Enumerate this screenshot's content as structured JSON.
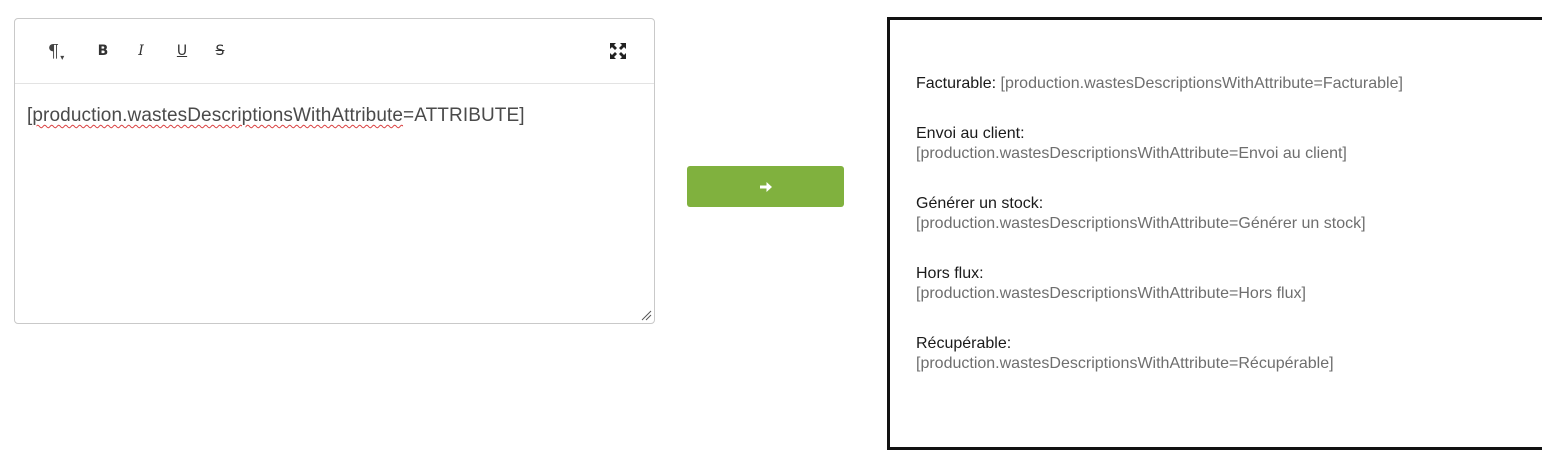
{
  "editor": {
    "toolbar": {
      "paragraph_icon": "paragraph-icon",
      "bold_label": "B",
      "italic_label": "I",
      "underline_label": "U",
      "strike_label": "S",
      "fullscreen_icon": "fullscreen-icon"
    },
    "content": {
      "open_bracket": "[",
      "misspelled": "production.wastesDescriptionsWithAttribute",
      "rest": "=ATTRIBUTE]"
    }
  },
  "convert_button": {
    "icon": "arrow-right-icon",
    "color": "#80b13e"
  },
  "preview": {
    "items": [
      {
        "label": "Facturable:",
        "value": "[production.wastesDescriptionsWithAttribute=Facturable]"
      },
      {
        "label": "Envoi au client:",
        "value": "[production.wastesDescriptionsWithAttribute=Envoi au client]"
      },
      {
        "label": "Générer un stock:",
        "value": "[production.wastesDescriptionsWithAttribute=Générer un stock]"
      },
      {
        "label": "Hors flux:",
        "value": "[production.wastesDescriptionsWithAttribute=Hors flux]"
      },
      {
        "label": "Récupérable:",
        "value": "[production.wastesDescriptionsWithAttribute=Récupérable]"
      }
    ]
  }
}
